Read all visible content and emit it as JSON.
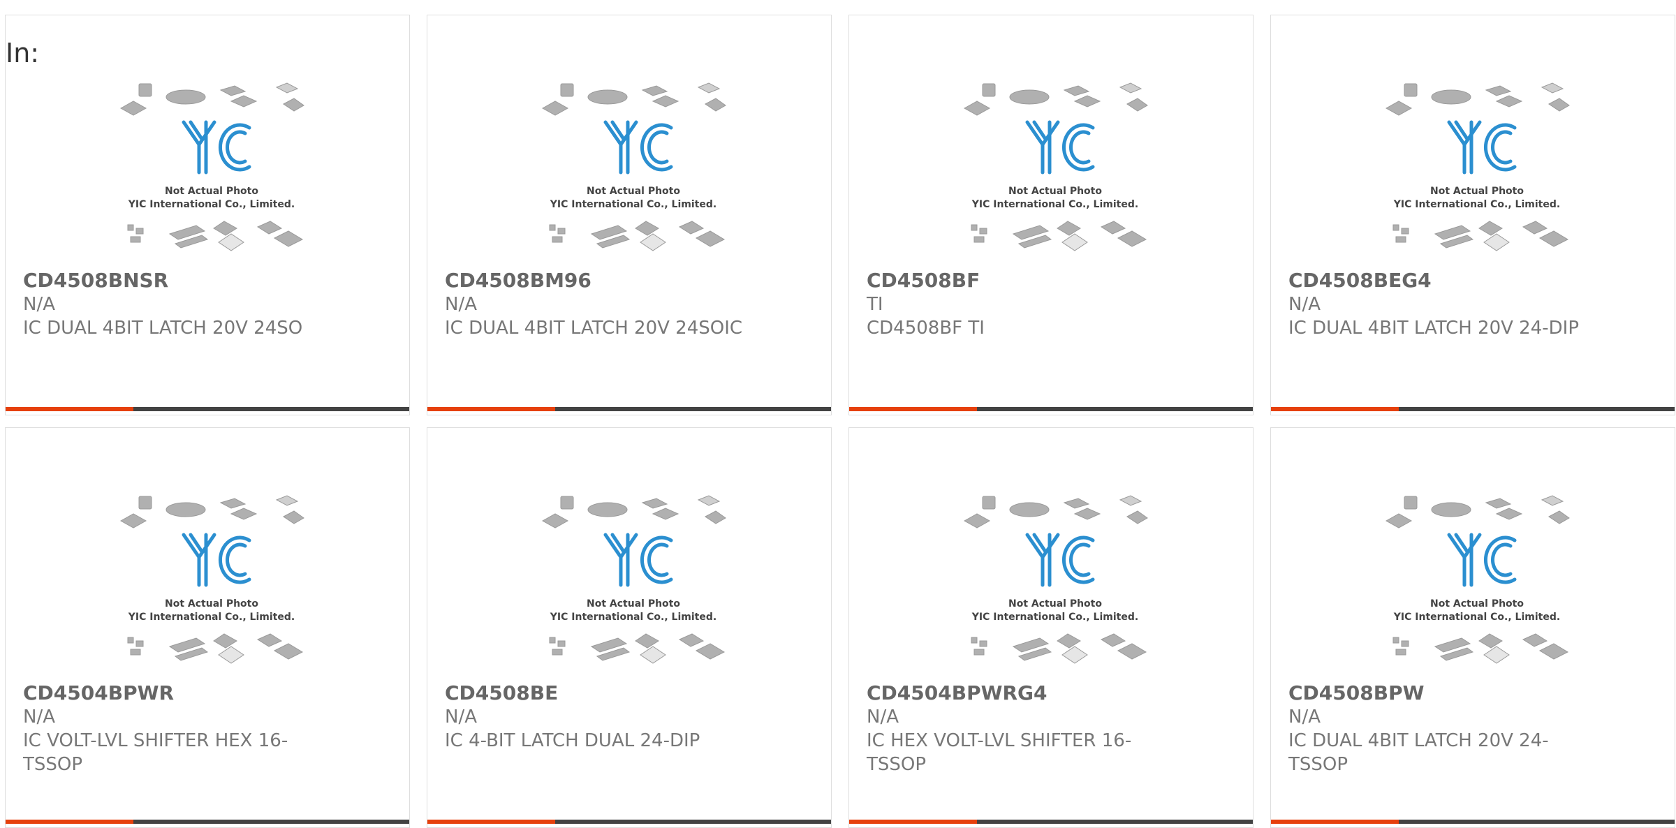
{
  "page": {
    "prefix_label": "In:"
  },
  "colors": {
    "accent": "#e6400c",
    "bar_dark": "#424242",
    "text": "#666666",
    "border": "#dedede",
    "logo_blue": "#2b8fd0"
  },
  "placeholder_image": {
    "line1": "Not Actual Photo",
    "line2": "YIC International Co., Limited.",
    "logo_text": "YIC"
  },
  "products": [
    {
      "part_number": "CD4508BNSR",
      "manufacturer": "N/A",
      "description": "IC DUAL 4BIT LATCH 20V 24SO"
    },
    {
      "part_number": "CD4508BM96",
      "manufacturer": "N/A",
      "description": "IC DUAL 4BIT LATCH 20V 24SOIC"
    },
    {
      "part_number": "CD4508BF",
      "manufacturer": "TI",
      "description": "CD4508BF TI"
    },
    {
      "part_number": "CD4508BEG4",
      "manufacturer": "N/A",
      "description": "IC DUAL 4BIT LATCH 20V 24-DIP"
    },
    {
      "part_number": "CD4504BPWR",
      "manufacturer": "N/A",
      "description": "IC VOLT-LVL SHIFTER HEX 16-TSSOP"
    },
    {
      "part_number": "CD4508BE",
      "manufacturer": "N/A",
      "description": "IC 4-BIT LATCH DUAL 24-DIP"
    },
    {
      "part_number": "CD4504BPWRG4",
      "manufacturer": "N/A",
      "description": "IC HEX VOLT-LVL SHIFTER 16-TSSOP"
    },
    {
      "part_number": "CD4508BPW",
      "manufacturer": "N/A",
      "description": "IC DUAL 4BIT LATCH 20V 24-TSSOP"
    }
  ]
}
